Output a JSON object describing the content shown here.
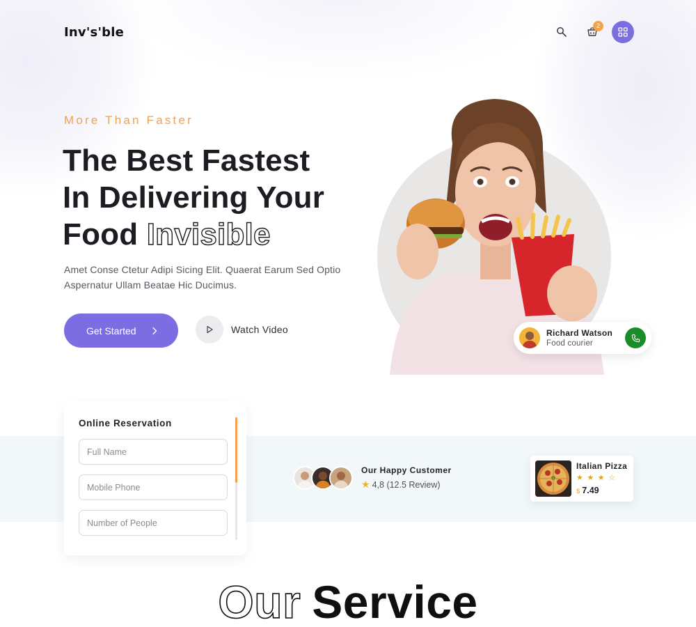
{
  "header": {
    "logo": "Inv's'ble",
    "cart_count": "2",
    "icons": [
      "search-icon",
      "cart-icon",
      "grid-menu-icon"
    ]
  },
  "hero": {
    "eyebrow": "More Than Faster",
    "title_line1": "The Best Fastest",
    "title_line2": "In Delivering Your",
    "title_line3_solid": "Food",
    "title_line3_outline": "Invisible",
    "description": "Amet Conse Ctetur Adipi Sicing Elit. Quaerat Earum Sed Optio Aspernatur Ullam Beatae Hic Ducimus.",
    "cta_label": "Get Started",
    "video_label": "Watch Video"
  },
  "courier": {
    "name": "Richard Watson",
    "role": "Food courier"
  },
  "reservation": {
    "title": "Online Reservation",
    "fields": [
      {
        "placeholder": "Full Name"
      },
      {
        "placeholder": "Mobile Phone"
      },
      {
        "placeholder": "Number of People"
      }
    ]
  },
  "customers": {
    "title": "Our Happy Customer",
    "rating": "4,8",
    "reviews": "(12.5 Review)"
  },
  "pizza": {
    "name": "Italian Pizza",
    "rating": 3,
    "rating_max": 4,
    "currency": "$",
    "price": "7.49"
  },
  "section": {
    "heading_outline": "Our",
    "heading_solid": "Service"
  },
  "colors": {
    "accent": "#7c6de2",
    "orange": "#f3a04f",
    "call_green": "#1a8c2a",
    "band": "#f2f8fa"
  }
}
